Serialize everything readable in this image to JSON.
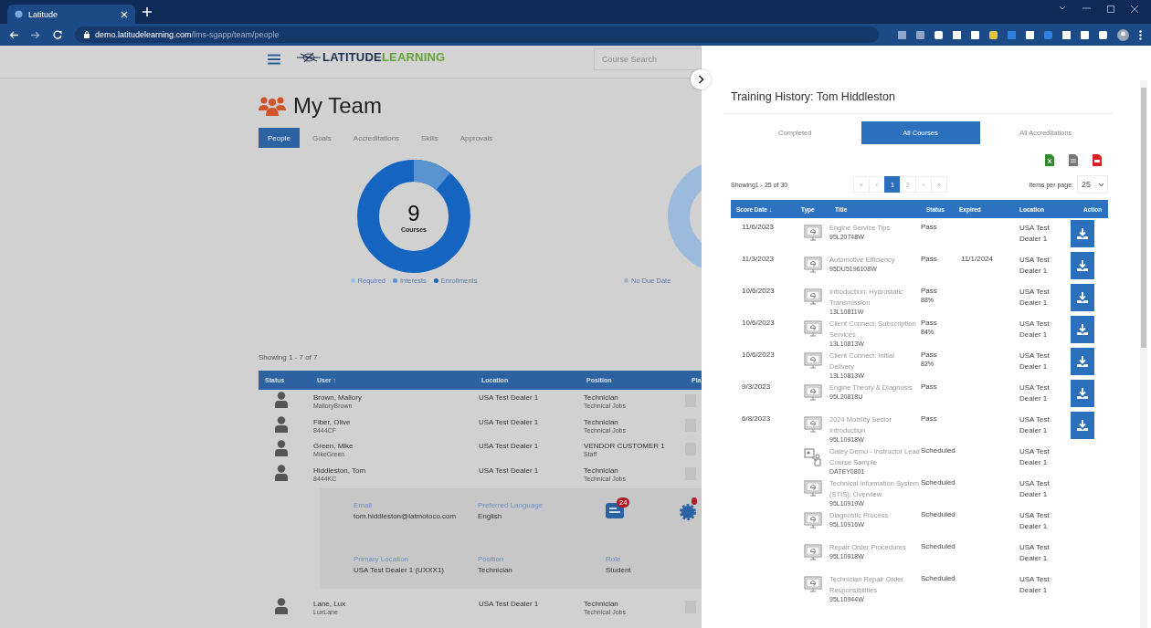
{
  "browser": {
    "tab_title": "Latitude",
    "url": "**demo.latitudelearning.com**/lms-sgapp/team/people"
  },
  "header": {
    "logo": {
      "part_1": "LATITUDE",
      "part_2": "LEARNING"
    },
    "search": {
      "placeholder": "Course Search"
    }
  },
  "team": {
    "title": "My Team",
    "tabs": [
      {
        "label": "People",
        "selected": true
      },
      {
        "label": "Goals",
        "selected": false
      },
      {
        "label": "Accreditations",
        "selected": false
      },
      {
        "label": "Skills",
        "selected": false
      },
      {
        "label": "Approvals",
        "selected": false
      }
    ],
    "donut": {
      "total": "9",
      "caption": "Courses",
      "legend": [
        {
          "label": "Required",
          "color": "#9fc0e4"
        },
        {
          "label": "Interests",
          "color": "#5a94d0"
        },
        {
          "label": "Enrollments",
          "color": "#1565c0"
        }
      ]
    },
    "donut_2": {
      "legend": [
        {
          "label": "No Due Date",
          "color": "#a9b3bd"
        }
      ]
    },
    "showing": "Showing 1 - 7 of 7",
    "table": {
      "columns": [
        "Status",
        "User ↑",
        "Location",
        "Position",
        "Pla"
      ],
      "rows": [
        {
          "name": "Brown, Mallory",
          "id": "MalloryBrown",
          "location": "USA Test Dealer 1",
          "position": "Technician",
          "job": "Technical Jobs"
        },
        {
          "name": "Fiber, Olive",
          "id": "8444CF",
          "location": "USA Test Dealer 1",
          "position": "Technician",
          "job": "Technical Jobs"
        },
        {
          "name": "Green, Mike",
          "id": "MikeGreen",
          "location": "USA Test Dealer 1",
          "position": "VENDOR CUSTOMER 1",
          "job": "Staff"
        },
        {
          "name": "Hiddleston, Tom",
          "id": "8444KC",
          "location": "USA Test Dealer 1",
          "position": "Technician",
          "job": "Technical Jobs"
        }
      ],
      "details": {
        "fields": [
          {
            "label": "Email",
            "value": "tom.hiddleston@latmotoco.com"
          },
          {
            "label": "Preferred Language",
            "value": "English"
          },
          {
            "label": "Primary Location",
            "value": "USA Test Dealer 1 (UXXX1)"
          },
          {
            "label": "Position",
            "value": "Technician"
          },
          {
            "label": "Role",
            "value": "Student"
          }
        ],
        "message_count": "24"
      },
      "rows_after": [
        {
          "name": "Lane, Lux",
          "id": "LuxLane",
          "location": "USA Test Dealer 1",
          "position": "Technician",
          "job": "Technical Jobs"
        }
      ]
    }
  },
  "panel": {
    "title": "Training History: Tom Hiddleston",
    "tabs": [
      {
        "label": "Completed",
        "selected": false
      },
      {
        "label": "All Courses",
        "selected": true
      },
      {
        "label": "All Accreditations",
        "selected": false
      }
    ],
    "showing": "Showing1 - 25 of 30",
    "pager": [
      {
        "label": "«",
        "selected": false
      },
      {
        "label": "‹",
        "selected": false
      },
      {
        "label": "1",
        "selected": true
      },
      {
        "label": "2",
        "selected": false
      },
      {
        "label": "›",
        "selected": false
      },
      {
        "label": "»",
        "selected": false
      }
    ],
    "items_per_page": {
      "label": "Items per page:",
      "value": "25"
    },
    "table": {
      "columns": [
        "Score Date ↓",
        "Type",
        "Title",
        "Status",
        "Expired",
        "Location",
        "Action"
      ],
      "rows": [
        {
          "date": "11/6/2023",
          "kind": "elearning",
          "title": "Engine Service Tips",
          "code": "95L20748W",
          "status": "Pass",
          "score": "",
          "expired": "",
          "location": "USA Test Dealer 1",
          "download": true
        },
        {
          "date": "11/3/2023",
          "kind": "elearning",
          "title": "Automotive Efficiency",
          "code": "95DU5196108W",
          "status": "Pass",
          "score": "",
          "expired": "11/1/2024",
          "location": "USA Test Dealer 1",
          "download": true
        },
        {
          "date": "10/6/2023",
          "kind": "elearning",
          "title": "Introduction: Hydrostatic Transmission",
          "code": "13L10811W",
          "status": "Pass",
          "score": "88%",
          "expired": "",
          "location": "USA Test Dealer 1",
          "download": true
        },
        {
          "date": "10/6/2023",
          "kind": "elearning",
          "title": "Client Connect: Subscription Services",
          "code": "13L10813W",
          "status": "Pass",
          "score": "84%",
          "expired": "",
          "location": "USA Test Dealer 1",
          "download": true
        },
        {
          "date": "10/6/2023",
          "kind": "elearning",
          "title": "Client Connect: Initial Delivery",
          "code": "13L10813W",
          "status": "Pass",
          "score": "82%",
          "expired": "",
          "location": "USA Test Dealer 1",
          "download": true
        },
        {
          "date": "9/3/2023",
          "kind": "elearning",
          "title": "Engine Theory & Diagnosis",
          "code": "95L20818U",
          "status": "Pass",
          "score": "",
          "expired": "",
          "location": "USA Test Dealer 1",
          "download": true
        },
        {
          "date": "6/8/2023",
          "kind": "elearning",
          "title": "2024 Mobility Sector Introduction",
          "code": "95L10918W",
          "status": "Pass",
          "score": "",
          "expired": "",
          "location": "USA Test Dealer 1",
          "download": true
        },
        {
          "date": "",
          "kind": "instructor",
          "title": "Oatey Demo - Instructor Lead Course Sample",
          "code": "DATEY0801",
          "status": "Scheduled",
          "score": "",
          "expired": "",
          "location": "USA Test Dealer 1",
          "download": false
        },
        {
          "date": "",
          "kind": "elearning",
          "title": "Technical Information System (STIS): Overview",
          "code": "95L10919W",
          "status": "Scheduled",
          "score": "",
          "expired": "",
          "location": "USA Test Dealer 1",
          "download": false
        },
        {
          "date": "",
          "kind": "elearning",
          "title": "Diagnostic Process",
          "code": "95L10916W",
          "status": "Scheduled",
          "score": "",
          "expired": "",
          "location": "USA Test Dealer 1",
          "download": false
        },
        {
          "date": "",
          "kind": "elearning",
          "title": "Repair Order Procedures",
          "code": "95L10918W",
          "status": "Scheduled",
          "score": "",
          "expired": "",
          "location": "USA Test Dealer 1",
          "download": false
        },
        {
          "date": "",
          "kind": "elearning",
          "title": "Technician Repair Order Responsibilities",
          "code": "95L10944W",
          "status": "Scheduled",
          "score": "",
          "expired": "",
          "location": "USA Test Dealer 1",
          "download": false
        }
      ]
    }
  }
}
